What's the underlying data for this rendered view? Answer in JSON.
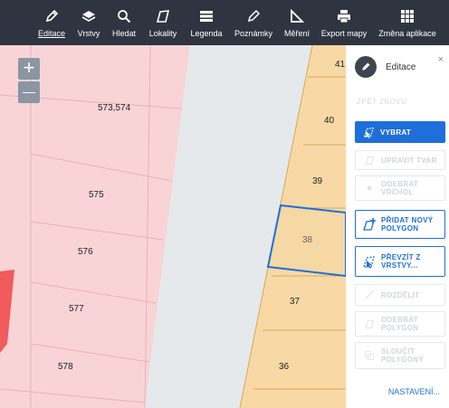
{
  "toolbar": {
    "items": [
      {
        "label": "Editace",
        "icon": "pencil-icon"
      },
      {
        "label": "Vrstvy",
        "icon": "layers-icon"
      },
      {
        "label": "Hledat",
        "icon": "search-icon"
      },
      {
        "label": "Lokality",
        "icon": "polygon-icon"
      },
      {
        "label": "Legenda",
        "icon": "legend-icon"
      },
      {
        "label": "Poznámky",
        "icon": "note-icon"
      },
      {
        "label": "Měření",
        "icon": "measure-icon"
      },
      {
        "label": "Export mapy",
        "icon": "printer-icon"
      },
      {
        "label": "Změna aplikace",
        "icon": "apps-icon"
      }
    ]
  },
  "map": {
    "zoom_in": "+",
    "zoom_out": "—",
    "parcels": [
      "573,574",
      "575",
      "576",
      "577",
      "578",
      "40",
      "39",
      "38",
      "37",
      "36",
      "41"
    ]
  },
  "panel": {
    "title": "Editace",
    "close": "×",
    "faded_top": "ZPĚT  ZNOVU",
    "buttons": {
      "vybrat": "VYBRAT",
      "d1": "UPRAVIT TVAR",
      "d2": "ODEBRAT VRCHOL",
      "add_polygon": "PŘIDAT NOVÝ POLYGON",
      "convert": "PŘEVZÍT Z VRSTVY...",
      "d3": "ROZDĚLIT",
      "d4": "ODEBRAT POLYGON",
      "d5": "SLOUČIT POLYGONY"
    },
    "settings": "NASTAVENÍ..."
  },
  "colors": {
    "toolbar": "#2f3540",
    "primary": "#1e6fd9",
    "parcel_pink": "#f9d4d7",
    "parcel_orange": "#f8d9a5"
  }
}
